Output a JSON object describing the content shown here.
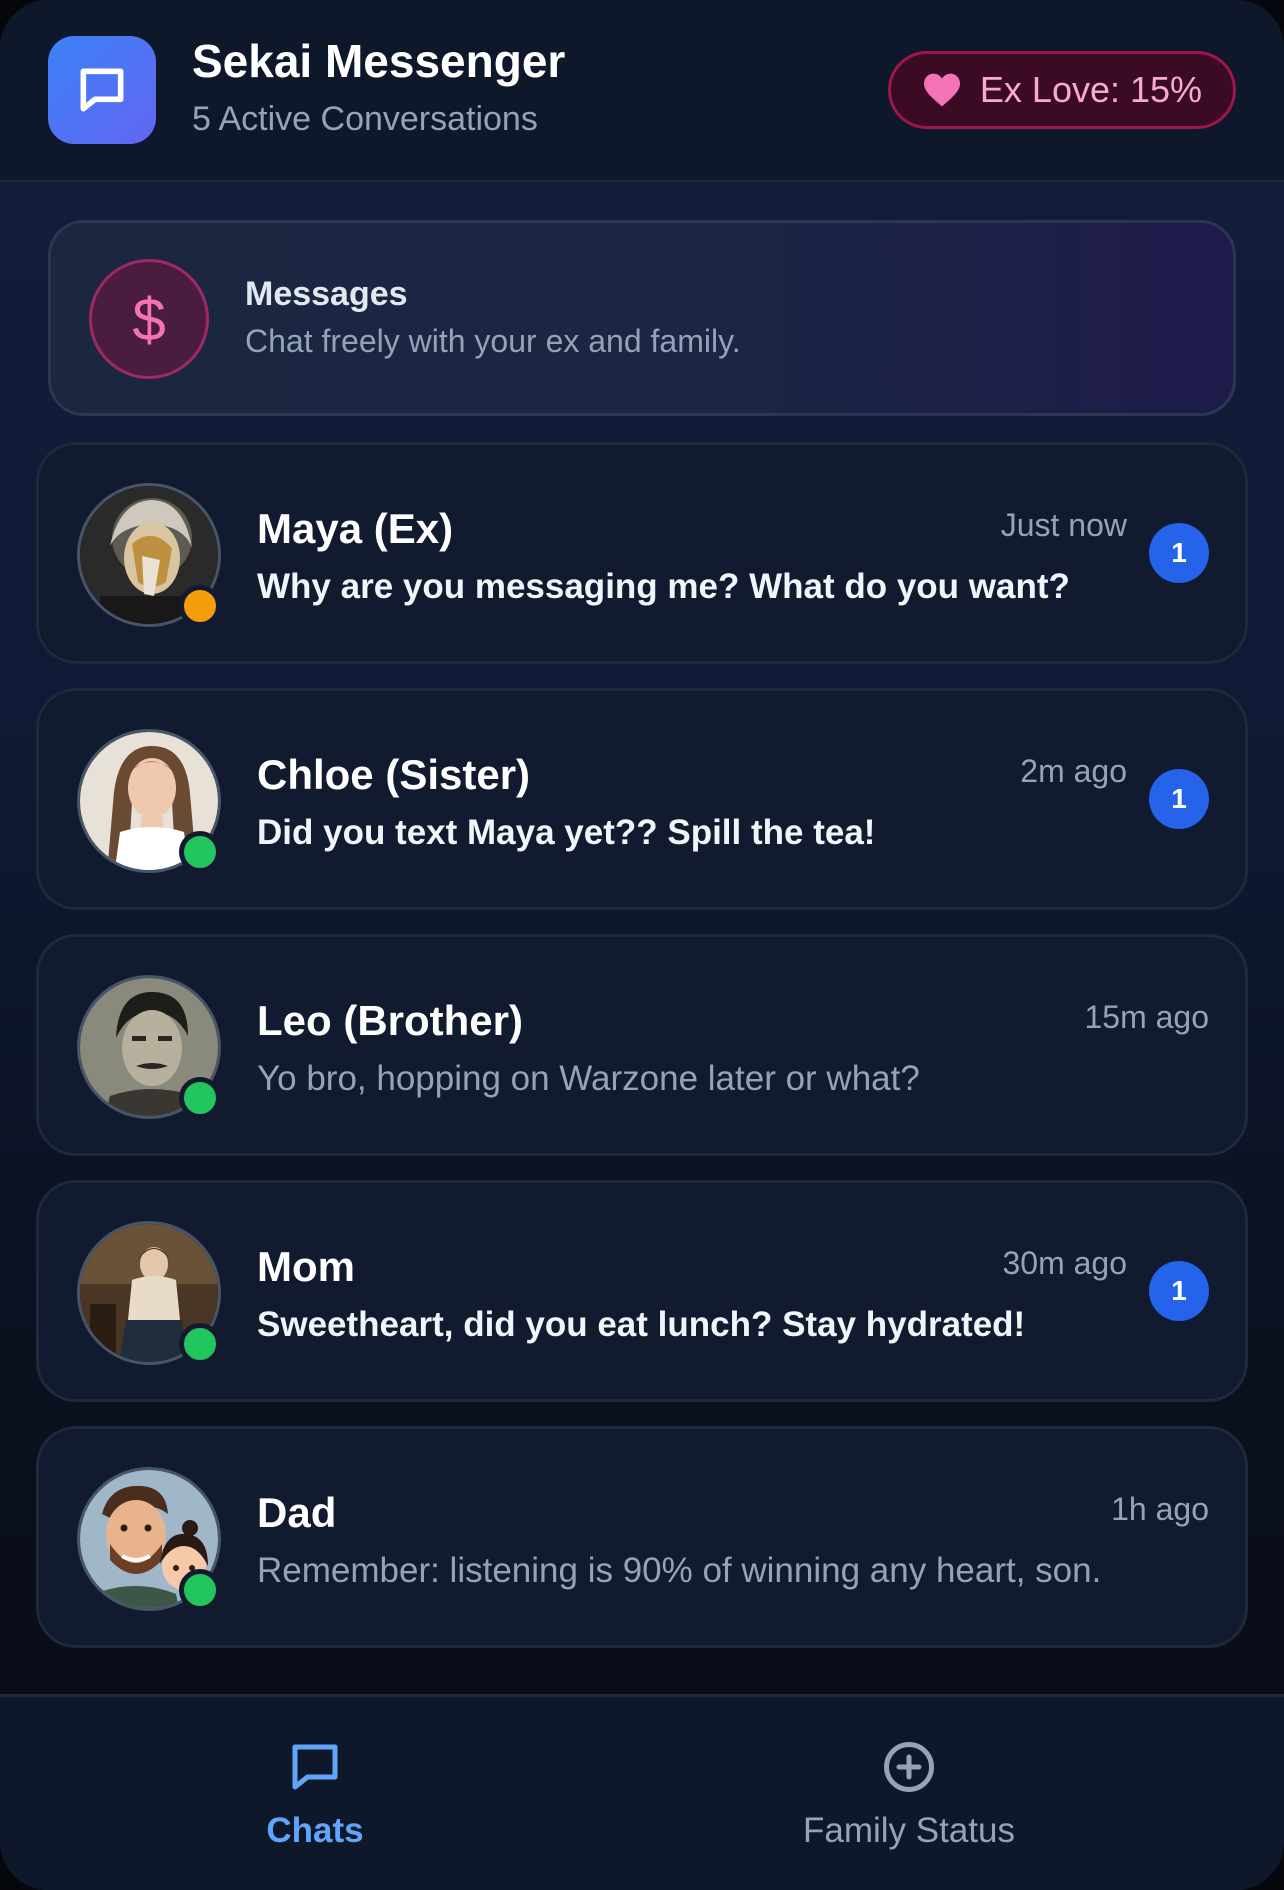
{
  "header": {
    "title": "Sekai Messenger",
    "subtitle": "5 Active Conversations",
    "logo_icon": "chat-bubble-icon",
    "love_icon": "heart-icon",
    "love_label": "Ex Love: 15%",
    "love_value": 15
  },
  "banner": {
    "icon": "dollar-icon",
    "icon_glyph": "$",
    "title": "Messages",
    "text": "Chat freely with your ex and family."
  },
  "chats": [
    {
      "name": "Maya (Ex)",
      "time": "Just now",
      "message": "Why are you messaging me? What do you want?",
      "unread": "1",
      "status_color": "#f59e0b"
    },
    {
      "name": "Chloe (Sister)",
      "time": "2m ago",
      "message": "Did you text Maya yet?? Spill the tea!",
      "unread": "1",
      "status_color": "#22c55e"
    },
    {
      "name": "Leo (Brother)",
      "time": "15m ago",
      "message": "Yo bro, hopping on Warzone later or what?",
      "unread": "",
      "status_color": "#22c55e"
    },
    {
      "name": "Mom",
      "time": "30m ago",
      "message": "Sweetheart, did you eat lunch? Stay hydrated!",
      "unread": "1",
      "status_color": "#22c55e"
    },
    {
      "name": "Dad",
      "time": "1h ago",
      "message": "Remember: listening is 90% of winning any heart, son.",
      "unread": "",
      "status_color": "#22c55e"
    }
  ],
  "nav": {
    "chats_label": "Chats",
    "chats_icon": "chat-bubble-icon",
    "family_label": "Family Status",
    "family_icon": "plus-circle-icon",
    "active_color": "#60a5fa",
    "inactive_color": "#94a3b8"
  }
}
